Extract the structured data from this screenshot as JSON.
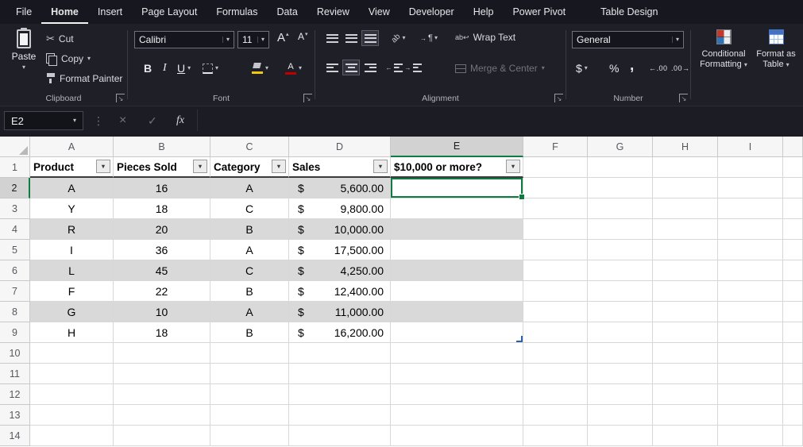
{
  "icons": {
    "dropdown": "▾",
    "filter": "▼",
    "cut": "✂",
    "cancel": "×",
    "enter": "✓",
    "insert_function": "fx",
    "overflow": "⋮",
    "dialog_launcher": "↘",
    "wrap_return": "↩",
    "paragraph": "¶",
    "arrow_right": "→",
    "arrow_left": "←",
    "letter_a": "A",
    "up_small": "▴",
    "down_small": "▾",
    "ab_glyph": "ab"
  },
  "menu": {
    "active_tab": "Home",
    "tabs": [
      "File",
      "Home",
      "Insert",
      "Page Layout",
      "Formulas",
      "Data",
      "Review",
      "View",
      "Developer",
      "Help",
      "Power Pivot",
      "Table Design"
    ]
  },
  "ribbon": {
    "clipboard": {
      "group_label": "Clipboard",
      "paste": "Paste",
      "cut": "Cut",
      "copy": "Copy",
      "format_painter": "Format Painter"
    },
    "font": {
      "group_label": "Font",
      "font_name": "Calibri",
      "font_size": "11",
      "bold": "B",
      "italic": "I",
      "underline": "U"
    },
    "alignment": {
      "group_label": "Alignment",
      "wrap_text": "Wrap Text",
      "merge_center": "Merge & Center"
    },
    "number": {
      "group_label": "Number",
      "format": "General",
      "currency": "$",
      "percent": "%",
      "comma": ",",
      "increase_decimal": "←.00",
      "decrease_decimal": ".00→"
    },
    "styles": {
      "conditional_formatting": "Conditional Formatting",
      "format_as_table": "Format as Table"
    }
  },
  "formula_bar": {
    "name_box": "E2",
    "formula": ""
  },
  "sheet": {
    "column_headers": [
      "A",
      "B",
      "C",
      "D",
      "E",
      "F",
      "G",
      "H",
      "I"
    ],
    "row_count": 14,
    "selected_cell": "E2",
    "selected_column": "E",
    "selected_row": 2,
    "table": {
      "headers": [
        "Product",
        "Pieces Sold",
        "Category",
        "Sales",
        "$10,000 or more?"
      ],
      "currency": "$",
      "rows": [
        {
          "product": "A",
          "pieces_sold": "16",
          "category": "A",
          "sales": "5,600.00"
        },
        {
          "product": "Y",
          "pieces_sold": "18",
          "category": "C",
          "sales": "9,800.00"
        },
        {
          "product": "R",
          "pieces_sold": "20",
          "category": "B",
          "sales": "10,000.00"
        },
        {
          "product": "I",
          "pieces_sold": "36",
          "category": "A",
          "sales": "17,500.00"
        },
        {
          "product": "L",
          "pieces_sold": "45",
          "category": "C",
          "sales": "4,250.00"
        },
        {
          "product": "F",
          "pieces_sold": "22",
          "category": "B",
          "sales": "12,400.00"
        },
        {
          "product": "G",
          "pieces_sold": "10",
          "category": "A",
          "sales": "11,000.00"
        },
        {
          "product": "H",
          "pieces_sold": "18",
          "category": "B",
          "sales": "16,200.00"
        }
      ]
    }
  },
  "colors": {
    "accent_green": "#107c41",
    "band_gray": "#d9d9d9",
    "selection_handle_blue": "#2f5fa8",
    "dark_chrome": "#1f1f28"
  }
}
